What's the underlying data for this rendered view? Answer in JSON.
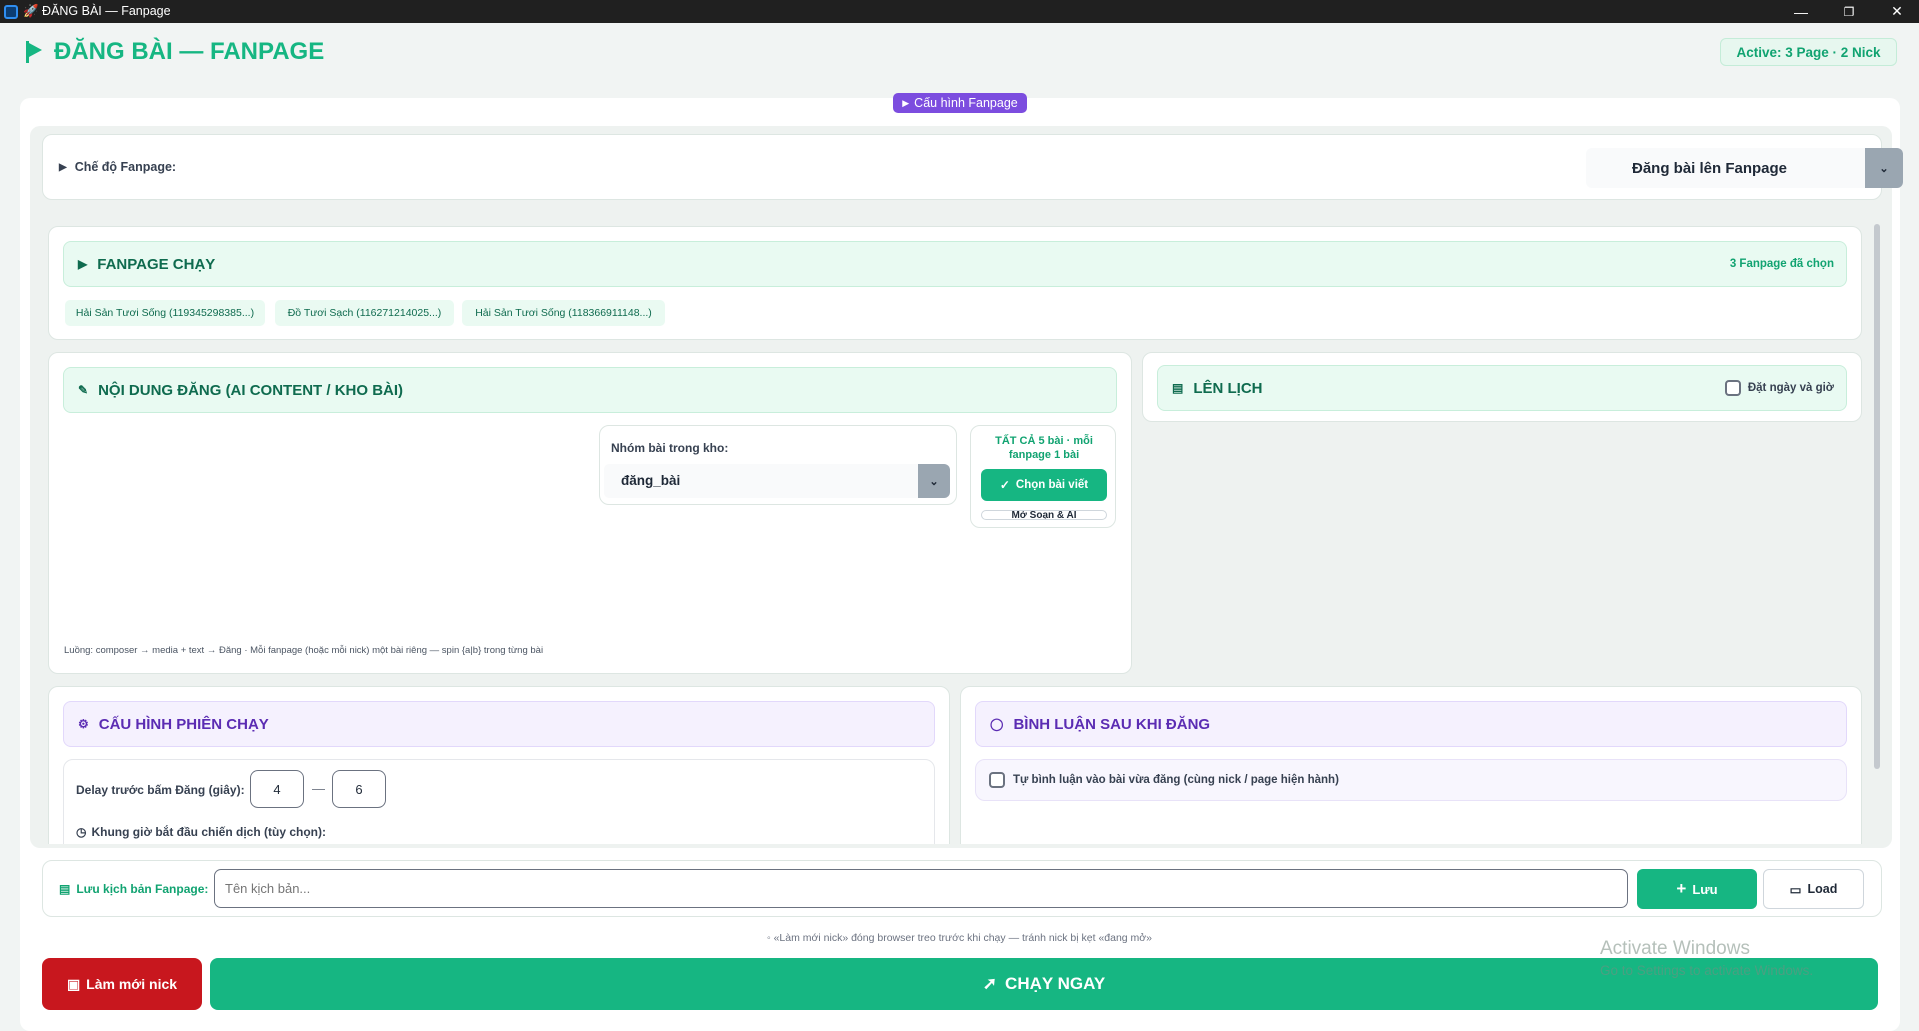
{
  "window": {
    "title": "🚀 ĐĂNG BÀI  — Fanpage",
    "controls": {
      "minimize": "—",
      "maximize": "❐",
      "close": "✕"
    }
  },
  "header": {
    "title": "ĐĂNG BÀI — FANPAGE",
    "active_badge": "Active: 3 Page · 2 Nick"
  },
  "config_pill": "Cấu hình Fanpage",
  "mode": {
    "label": "Chế độ Fanpage:",
    "selected": "Đăng bài lên Fanpage"
  },
  "fanpage_section": {
    "title": "FANPAGE CHẠY",
    "count": "3 Fanpage đã chọn",
    "chips": [
      "Hải Sản Tươi Sống (119345298385...)",
      "Đồ Tươi Sạch (116271214025...)",
      "Hải Sản Tươi Sống (118366911148...)"
    ]
  },
  "content_section": {
    "title": "NỘI DUNG ĐĂNG (AI CONTENT / KHO BÀI)",
    "group_label": "Nhóm bài trong kho:",
    "group_value": "đăng_bài",
    "all_posts_line1": "TẤT CẢ 5 bài · mỗi",
    "all_posts_line2": "fanpage 1 bài",
    "choose_button": "Chọn bài viết",
    "open_editor_button": "Mở Soạn & AI",
    "flow_note": "Luồng: composer → media + text → Đăng · Mỗi fanpage (hoặc mỗi nick) một bài riêng — spin {a|b} trong từng bài"
  },
  "schedule_section": {
    "title": "LÊN LỊCH",
    "checkbox_label": "Đặt ngày và giờ"
  },
  "session_section": {
    "title": "CẤU HÌNH PHIÊN CHẠY",
    "delay_label": "Delay trước bấm Đăng (giây):",
    "delay_min": "4",
    "delay_sep": "—",
    "delay_max": "6",
    "time_window_label": "Khung giờ bắt đầu chiến dịch (tùy chọn):"
  },
  "comment_section": {
    "title": "BÌNH LUẬN SAU KHI ĐĂNG",
    "checkbox_label": "Tự bình luận vào bài vừa đăng (cùng nick / page hiện hành)"
  },
  "script_save": {
    "label": "Lưu kịch bản Fanpage:",
    "placeholder": "Tên kịch bản...",
    "save_button": "Lưu",
    "load_button": "Load"
  },
  "footer": {
    "note": "«Làm mới nick» đóng browser treo trước khi chạy — tránh nick bị kẹt «đang mở»",
    "refresh_button": "Làm mới nick",
    "run_button": "CHẠY NGAY"
  },
  "watermark": {
    "line1": "Activate Windows",
    "line2": "Go to Settings to activate Windows."
  },
  "colors": {
    "accent": "#16b682",
    "purple": "#7c4ddf",
    "danger": "#c8171e"
  }
}
